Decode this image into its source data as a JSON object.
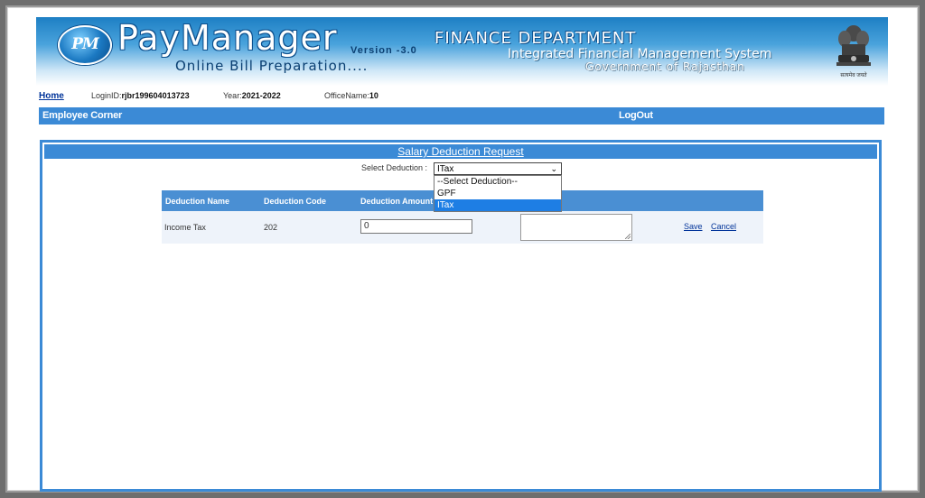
{
  "banner": {
    "logo_text": "PM",
    "app_title": "PayManager",
    "version": "Version -3.0",
    "subtitle": "Online Bill Preparation....",
    "department": "FINANCE  DEPARTMENT",
    "system": "Integrated Financial Management System",
    "government": "Government of Rajasthan",
    "emblem_text": "सत्यमेव जयते"
  },
  "info": {
    "home_link": "Home",
    "login_label": "LoginID:",
    "login_value": "rjbr199604013723",
    "year_label": "Year:",
    "year_value": "2021-2022",
    "office_label": "OfficeName:",
    "office_value": "10"
  },
  "nav": {
    "employee_corner": "Employee Corner",
    "logout": "LogOut"
  },
  "panel": {
    "title": "Salary Deduction Request",
    "select_label": "Select Deduction :",
    "select_value": "ITax",
    "options": [
      "--Select Deduction--",
      "GPF",
      "ITax"
    ],
    "selected_option_index": 2
  },
  "table": {
    "headers": [
      "Deduction Name",
      "Deduction Code",
      "Deduction Amount"
    ],
    "row": {
      "name": "Income Tax",
      "code": "202",
      "amount": "0",
      "save": "Save",
      "cancel": "Cancel"
    }
  },
  "colors": {
    "nav_blue": "#3b8ad6",
    "table_head": "#4a8fd3",
    "selected_option": "#1e7ee4",
    "link": "#003399"
  }
}
